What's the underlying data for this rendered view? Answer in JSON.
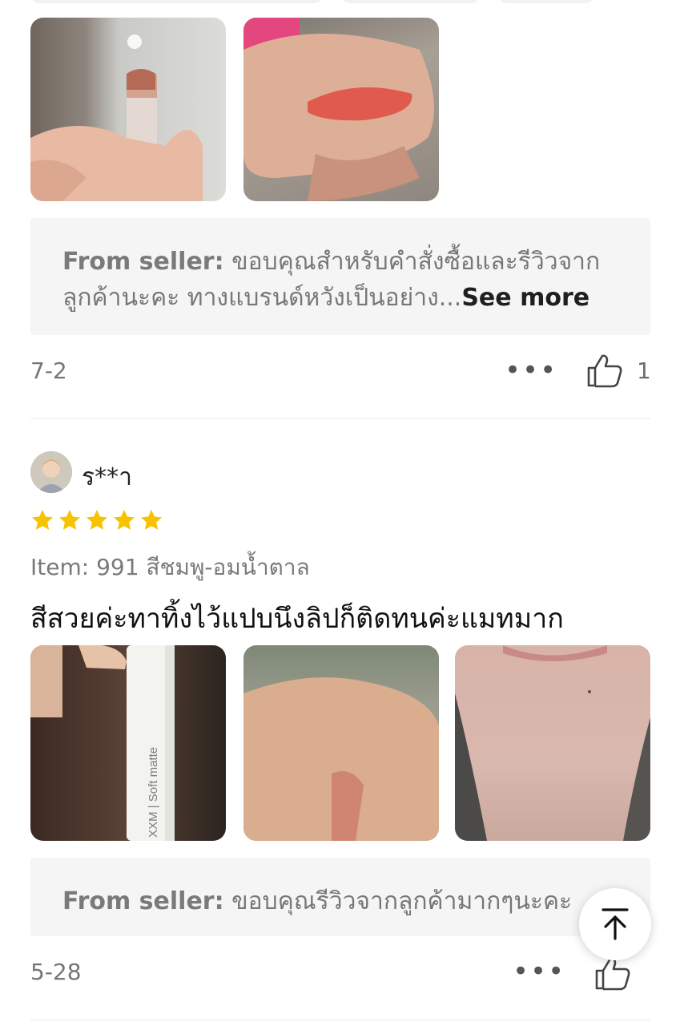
{
  "review_1": {
    "photos": [
      "lipstick-photo",
      "swatch-photo"
    ],
    "seller_reply": {
      "label": "From seller:",
      "line1": "ขอบคุณสำหรับคำสั่งซื้อและรีวิวจาก",
      "line2": "ลูกค้านะคะ ทางแบรนด์หวังเป็นอย่าง...",
      "see_more": "See more"
    },
    "date": "7-2",
    "menu": "•••",
    "like_count": "1"
  },
  "review_2": {
    "username": "ร**า",
    "rating": 5,
    "item": "Item: 991 สีชมพู-อมน้ำตาล",
    "text": "สีสวยค่ะทาทิ้งไว้แปบนึงลิปก็ติดทนค่ะแมทมาก",
    "product_print": "XXM | Soft matte",
    "seller_reply": {
      "label": "From seller:",
      "line1": "ขอบคุณรีวิวจากลูกค้ามากๆนะคะ"
    },
    "date": "5-28",
    "menu": "•••"
  },
  "colors": {
    "star": "#f7c300",
    "seller_bg": "#f5f5f5",
    "text_muted": "#777777"
  },
  "icons": {
    "like": "thumbs-up-icon",
    "more": "more-dots-icon",
    "scroll_top": "arrow-up-to-top-icon"
  }
}
